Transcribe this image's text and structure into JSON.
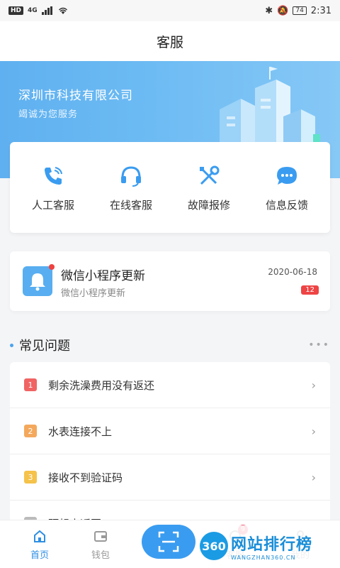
{
  "status_bar": {
    "left_badge": "HD",
    "network": "4G",
    "battery": "74",
    "time": "2:31"
  },
  "header": {
    "title": "客服"
  },
  "hero": {
    "company": "深圳市科技有限公司",
    "slogan": "竭诚为您服务"
  },
  "services": [
    {
      "label": "人工客服",
      "icon": "phone-icon"
    },
    {
      "label": "在线客服",
      "icon": "headset-icon"
    },
    {
      "label": "故障报修",
      "icon": "tools-icon"
    },
    {
      "label": "信息反馈",
      "icon": "chat-icon"
    }
  ],
  "notice": {
    "title": "微信小程序更新",
    "subtitle": "微信小程序更新",
    "date": "2020-06-18",
    "count": "12",
    "icon": "bell-icon"
  },
  "faq": {
    "title": "常见问题",
    "more": "•••",
    "items": [
      {
        "num": "1",
        "text": "剩余洗澡费用没有返还",
        "color": "#f06464"
      },
      {
        "num": "2",
        "text": "水表连接不上",
        "color": "#f4a85c"
      },
      {
        "num": "3",
        "text": "接收不到验证码",
        "color": "#f5c24a"
      },
      {
        "num": "4",
        "text": "预想未返回",
        "color": "#bbbbbb"
      }
    ]
  },
  "bottom_nav": {
    "items": [
      {
        "label": "首页",
        "active": true,
        "icon": "home-icon"
      },
      {
        "label": "钱包",
        "active": false,
        "icon": "wallet-icon"
      },
      {
        "label": "客服",
        "active": false,
        "icon": "service-icon"
      },
      {
        "label": "我的",
        "active": false,
        "icon": "user-icon"
      }
    ],
    "badge": "9",
    "scan_icon": "scan-icon"
  },
  "watermark": {
    "logo": "360",
    "cn": "网站排行榜",
    "en": "WANGZHAN360.CN"
  },
  "colors": {
    "accent": "#3a9cf0",
    "hero_start": "#5fb0f0",
    "badge_red": "#ee4444"
  }
}
